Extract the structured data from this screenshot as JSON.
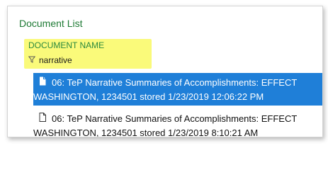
{
  "panel": {
    "title": "Document List"
  },
  "filter": {
    "column_name": "DOCUMENT NAME",
    "icon": "filter-icon",
    "value": "narrative"
  },
  "documents": [
    {
      "icon": "document-icon",
      "selected": true,
      "line1": "06: TeP Narrative Summaries of Accomplishments: EFFECT",
      "line2": "WASHINGTON, 1234501 stored 1/23/2019 12:06:22 PM"
    },
    {
      "icon": "document-icon",
      "selected": false,
      "line1": "06: TeP Narrative Summaries of Accomplishments: EFFECT",
      "line2": "WASHINGTON, 1234501 stored 1/23/2019 8:10:21 AM"
    }
  ],
  "colors": {
    "title_green": "#1e7a34",
    "highlight_yellow": "#fafa7a",
    "selection_blue": "#1f7fd8"
  }
}
